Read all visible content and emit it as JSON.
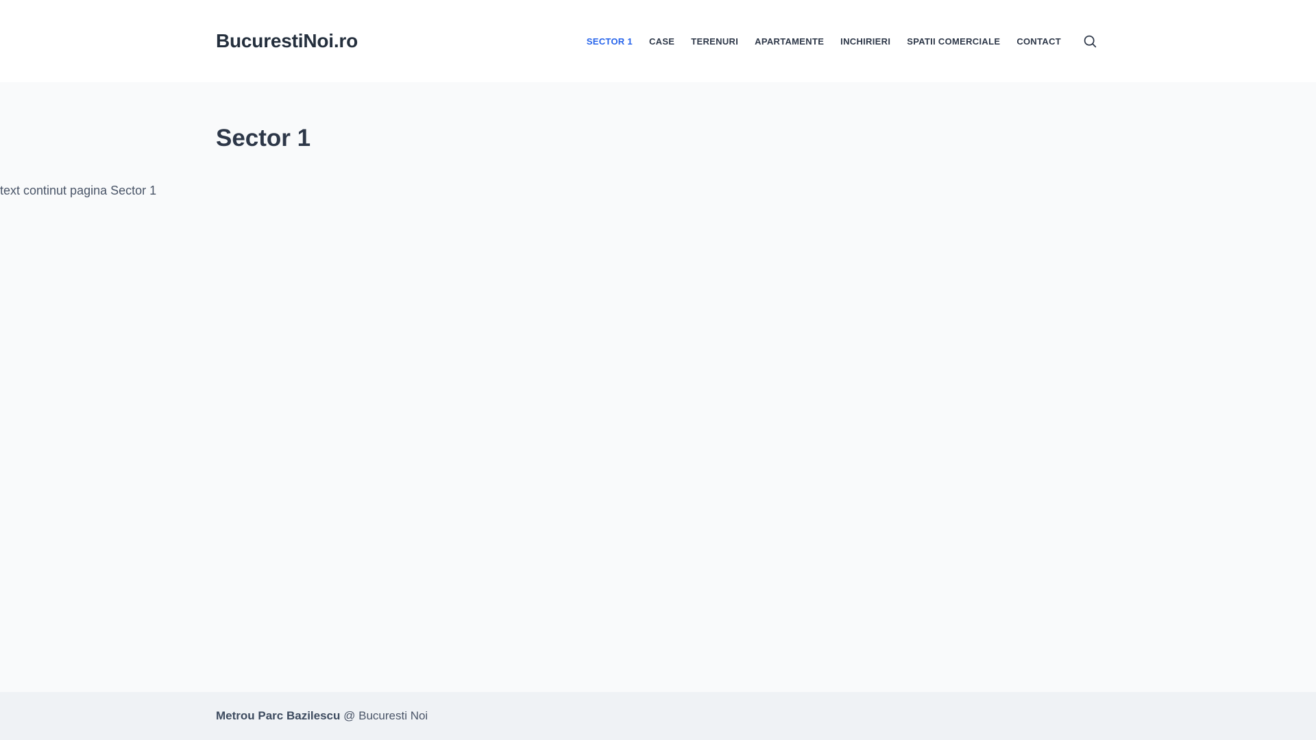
{
  "header": {
    "logo": "BucurestiNoi.ro",
    "nav": [
      {
        "label": "SECTOR 1",
        "active": true
      },
      {
        "label": "CASE",
        "active": false
      },
      {
        "label": "TERENURI",
        "active": false
      },
      {
        "label": "APARTAMENTE",
        "active": false
      },
      {
        "label": "INCHIRIERI",
        "active": false
      },
      {
        "label": "SPATII COMERCIALE",
        "active": false
      },
      {
        "label": "CONTACT",
        "active": false
      }
    ],
    "search_icon": "search-magnifier"
  },
  "main": {
    "page_title": "Sector 1",
    "body_text": "text continut pagina Sector 1"
  },
  "footer": {
    "site_name": "Metrou Parc Bazilescu",
    "suffix": " @ Bucuresti Noi"
  },
  "colors": {
    "accent_link": "#2563eb",
    "heading": "#2d3748",
    "logo": "#242f3d",
    "body_text": "#4a5568",
    "header_bg": "#ffffff",
    "content_bg": "#f9fafb",
    "footer_bg": "#eff2f5"
  }
}
